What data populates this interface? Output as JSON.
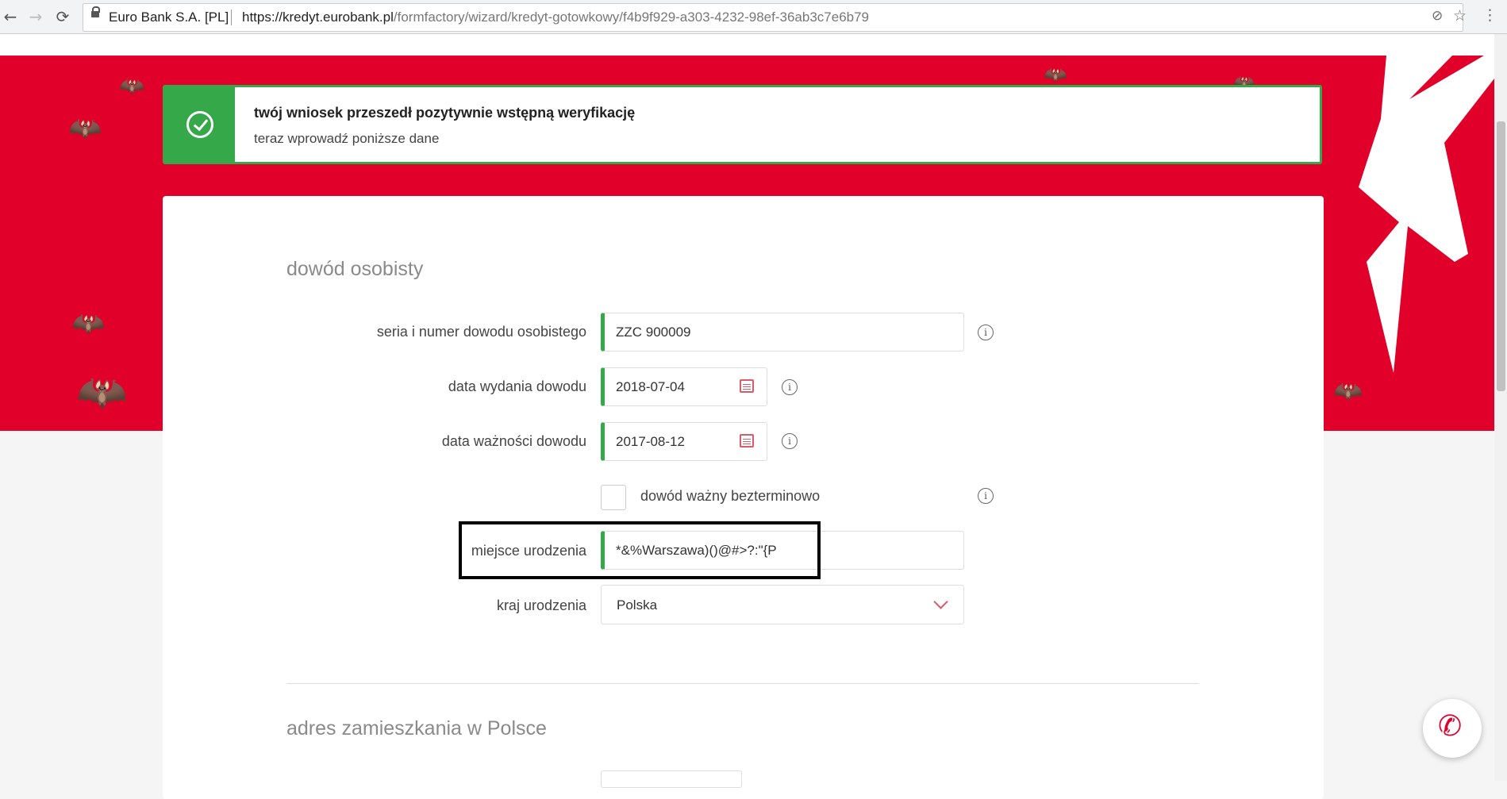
{
  "browser": {
    "site_name": "Euro Bank S.A. [PL]",
    "url_host": "https://kredyt.eurobank.pl",
    "url_path": "/formfactory/wizard/kredyt-gotowkowy/f4b9f929-a303-4232-98ef-36ab3c7e6b79",
    "icons": [
      "back-icon",
      "forward-icon",
      "reload-icon",
      "lock-icon",
      "extension-icon",
      "star-icon",
      "menu-icon"
    ]
  },
  "banner": {
    "title": "twój wniosek przeszedł pozytywnie wstępną weryfikację",
    "subtitle": "teraz wprowadź poniższe dane"
  },
  "id_section": {
    "title": "dowód osobisty",
    "id_number": {
      "label": "seria i numer dowodu osobistego",
      "value": "ZZC 900009"
    },
    "issue_date": {
      "label": "data wydania dowodu",
      "value": "2018-07-04"
    },
    "expiry_date": {
      "label": "data ważności dowodu",
      "value": "2017-08-12"
    },
    "indefinite": {
      "label": "dowód ważny bezterminowo",
      "checked": false
    },
    "birth_place": {
      "label": "miejsce urodzenia",
      "value": "*&%Warszawa)()@#>?:\"{P"
    },
    "birth_country": {
      "label": "kraj urodzenia",
      "value": "Polska"
    }
  },
  "address_section": {
    "title": "adres zamieszkania w Polsce"
  },
  "colors": {
    "brand_red": "#e0002a",
    "success_green": "#35a84a"
  },
  "icons": {
    "info": "i",
    "phone": "✆"
  }
}
